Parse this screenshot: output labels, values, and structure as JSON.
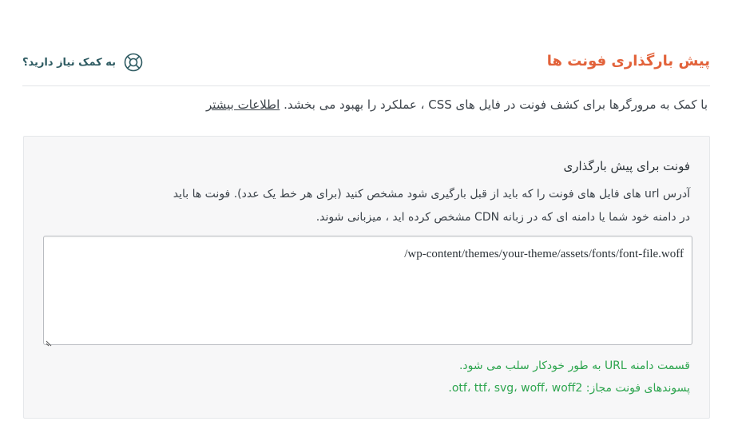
{
  "header": {
    "title": "پیش بارگذاری فونت ها",
    "help_label": "به کمک نیاز دارید؟",
    "help_icon": "lifebuoy-icon"
  },
  "description": {
    "text": "با کمک به مرورگرها برای کشف فونت در فایل های CSS ، عملکرد را بهبود می بخشد.",
    "link_label": "اطلاعات بیشتر"
  },
  "field": {
    "label": "فونت برای پیش بارگذاری",
    "help_line1": "آدرس url های فایل های فونت را که باید از قبل بارگیری شود مشخص کنید (برای هر خط یک عدد). فونت ها باید",
    "help_line2": "در دامنه خود شما یا دامنه ای که در زبانه CDN مشخص کرده اید ، میزبانی شوند.",
    "value": "/wp-content/themes/your-theme/assets/fonts/font-file.woff",
    "note1": "قسمت دامنه URL به طور خودکار سلب می شود.",
    "note2": "پسوندهای فونت مجاز: otf، ttf، svg، woff، woff2."
  },
  "colors": {
    "accent": "#e2623a",
    "help_teal": "#2d5a61",
    "success_green": "#2ea54f"
  }
}
